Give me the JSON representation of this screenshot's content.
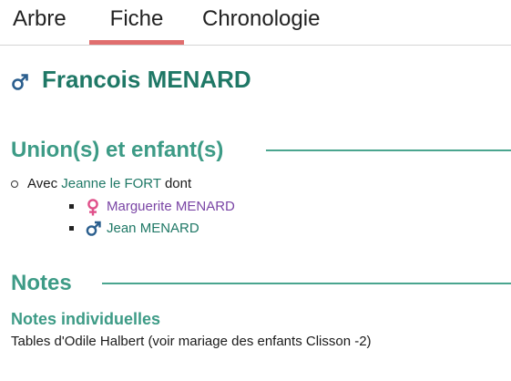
{
  "tabs": [
    {
      "label": "Arbre",
      "active": false
    },
    {
      "label": "Fiche",
      "active": true
    },
    {
      "label": "Chronologie",
      "active": false
    }
  ],
  "person": {
    "name": "Francois MENARD",
    "sex_icon": "male-icon"
  },
  "unions": {
    "heading": "Union(s) et enfant(s)",
    "items": [
      {
        "prefix": "Avec",
        "spouse": "Jeanne le FORT",
        "suffix": "dont",
        "children": [
          {
            "name": "Marguerite MENARD",
            "sex_icon": "female-icon"
          },
          {
            "name": "Jean MENARD",
            "sex_icon": "male-icon"
          }
        ]
      }
    ]
  },
  "notes": {
    "heading": "Notes",
    "subheading": "Notes individuelles",
    "text": "Tables d'Odile Halbert (voir mariage des enfants Clisson -2)"
  },
  "colors": {
    "accent_tab": "#e06e6e",
    "heading": "#3d9b86",
    "person_name": "#1f7866",
    "link": "#1f7866",
    "female_link": "#7a45a5",
    "male_symbol": "#2b5f8e",
    "female_symbol": "#e0508a"
  }
}
